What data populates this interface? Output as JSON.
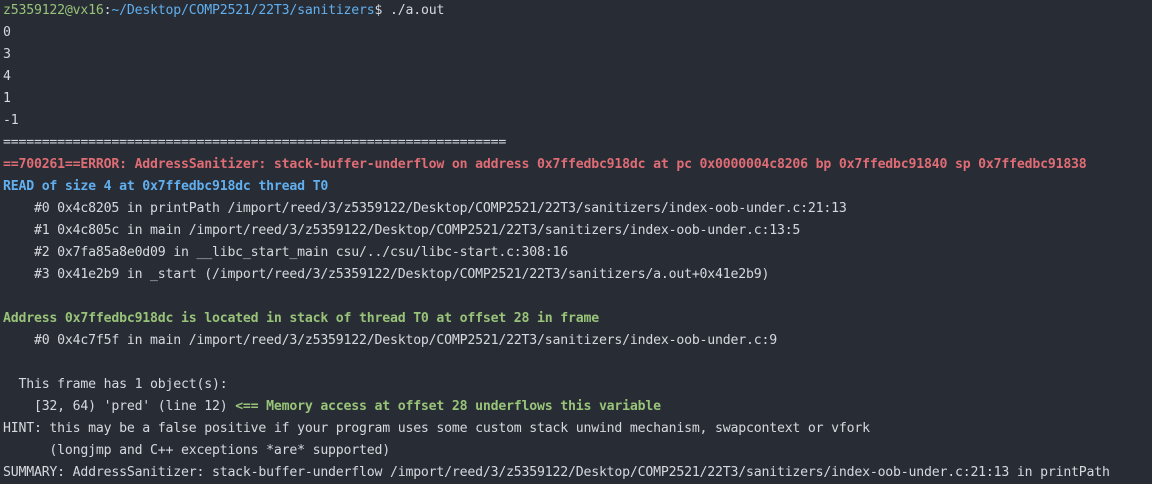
{
  "prompt": {
    "user_host": "z5359122@vx16",
    "sep": ":",
    "path": "~/Desktop/COMP2521/22T3/sanitizers",
    "symbol": "$ ",
    "command": "./a.out"
  },
  "output": [
    "0",
    "3",
    "4",
    "1",
    "-1"
  ],
  "separator": "=================================================================",
  "error_line": "==700261==ERROR: AddressSanitizer: stack-buffer-underflow on address 0x7ffedbc918dc at pc 0x0000004c8206 bp 0x7ffedbc91840 sp 0x7ffedbc91838",
  "read_line": "READ of size 4 at 0x7ffedbc918dc thread T0",
  "stack": [
    "    #0 0x4c8205 in printPath /import/reed/3/z5359122/Desktop/COMP2521/22T3/sanitizers/index-oob-under.c:21:13",
    "    #1 0x4c805c in main /import/reed/3/z5359122/Desktop/COMP2521/22T3/sanitizers/index-oob-under.c:13:5",
    "    #2 0x7fa85a8e0d09 in __libc_start_main csu/../csu/libc-start.c:308:16",
    "    #3 0x41e2b9 in _start (/import/reed/3/z5359122/Desktop/COMP2521/22T3/sanitizers/a.out+0x41e2b9)"
  ],
  "address_line": "Address 0x7ffedbc918dc is located in stack of thread T0 at offset 28 in frame",
  "frame_line": "    #0 0x4c7f5f in main /import/reed/3/z5359122/Desktop/COMP2521/22T3/sanitizers/index-oob-under.c:9",
  "frame_objects": "  This frame has 1 object(s):",
  "object_prefix": "    [32, 64) 'pred' (line 12) ",
  "object_note": "<== Memory access at offset 28 underflows this variable",
  "hint_1": "HINT: this may be a false positive if your program uses some custom stack unwind mechanism, swapcontext or vfork",
  "hint_2": "      (longjmp and C++ exceptions *are* supported)",
  "summary": "SUMMARY: AddressSanitizer: stack-buffer-underflow /import/reed/3/z5359122/Desktop/COMP2521/22T3/sanitizers/index-oob-under.c:21:13 in printPath",
  "colors": {
    "background": "#282c34",
    "text": "#d5d9df",
    "green": "#98c379",
    "cyan": "#61afef",
    "red": "#e06c75"
  }
}
